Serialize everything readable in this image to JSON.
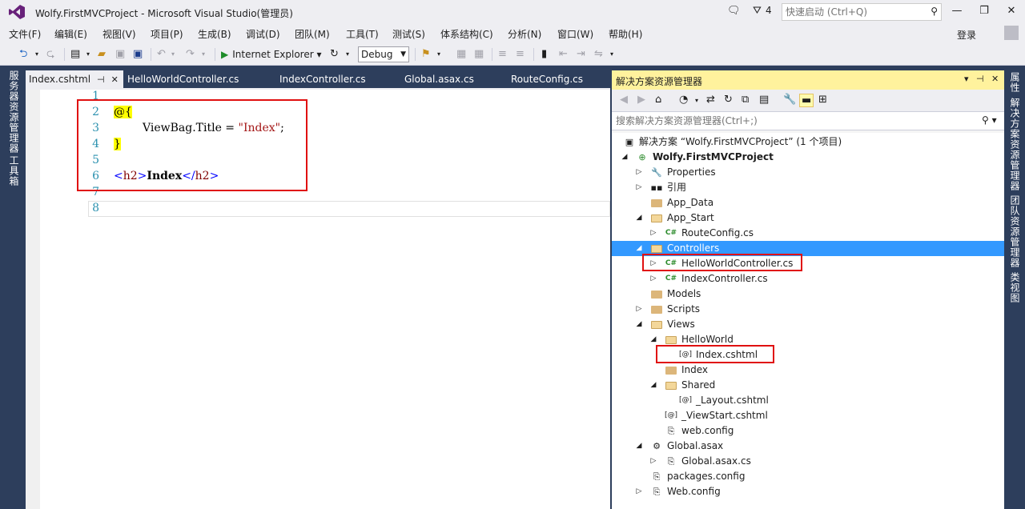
{
  "window": {
    "title": "Wolfy.FirstMVCProject - Microsoft Visual Studio(管理员)",
    "notification_count": "4",
    "quick_launch_placeholder": "快速启动 (Ctrl+Q)",
    "sign_in": "登录"
  },
  "menu": [
    "文件(F)",
    "编辑(E)",
    "视图(V)",
    "项目(P)",
    "生成(B)",
    "调试(D)",
    "团队(M)",
    "工具(T)",
    "测试(S)",
    "体系结构(C)",
    "分析(N)",
    "窗口(W)",
    "帮助(H)"
  ],
  "toolbar": {
    "run_target": "Internet Explorer",
    "configuration": "Debug"
  },
  "left_side_tabs": [
    "服务器资源管理器",
    "工具箱"
  ],
  "right_side_tabs": [
    "属性",
    "解决方案资源管理器",
    "团队资源管理器",
    "类视图"
  ],
  "editor": {
    "tabs": [
      "Index.cshtml",
      "HelloWorldController.cs",
      "IndexController.cs",
      "Global.asax.cs",
      "RouteConfig.cs"
    ],
    "active_tab": "Index.cshtml",
    "line_numbers": [
      "1",
      "2",
      "3",
      "4",
      "5",
      "6",
      "7",
      "8"
    ],
    "code": {
      "l2_razor": "@{",
      "l3_prop": "ViewBag.Title = ",
      "l3_str": "\"Index\"",
      "l3_end": ";",
      "l4_razor": "}",
      "l6_open_br": "<",
      "l6_open_nm": "h2",
      "l6_open_br2": ">",
      "l6_text": "Index",
      "l6_close_br": "</",
      "l6_close_nm": "h2",
      "l6_close_br2": ">"
    }
  },
  "solution_explorer": {
    "title": "解决方案资源管理器",
    "search_placeholder": "搜索解决方案资源管理器(Ctrl+;)",
    "nodes": [
      {
        "label": "解决方案 “Wolfy.FirstMVCProject” (1 个项目)"
      },
      {
        "label": "Wolfy.FirstMVCProject"
      },
      {
        "label": "Properties"
      },
      {
        "label": "引用"
      },
      {
        "label": "App_Data"
      },
      {
        "label": "App_Start"
      },
      {
        "label": "RouteConfig.cs"
      },
      {
        "label": "Controllers"
      },
      {
        "label": "HelloWorldController.cs"
      },
      {
        "label": "IndexController.cs"
      },
      {
        "label": "Models"
      },
      {
        "label": "Scripts"
      },
      {
        "label": "Views"
      },
      {
        "label": "HelloWorld"
      },
      {
        "label": "Index.cshtml"
      },
      {
        "label": "Index"
      },
      {
        "label": "Shared"
      },
      {
        "label": "_Layout.cshtml"
      },
      {
        "label": "_ViewStart.cshtml"
      },
      {
        "label": "web.config"
      },
      {
        "label": "Global.asax"
      },
      {
        "label": "Global.asax.cs"
      },
      {
        "label": "packages.config"
      },
      {
        "label": "Web.config"
      }
    ]
  },
  "colors": {
    "chrome": "#eeeef2",
    "frame": "#2d3e5c",
    "selection": "#3399ff",
    "highlight_box": "#e01010",
    "razor_bg": "#ffff00",
    "panel_header": "#fff29d"
  }
}
